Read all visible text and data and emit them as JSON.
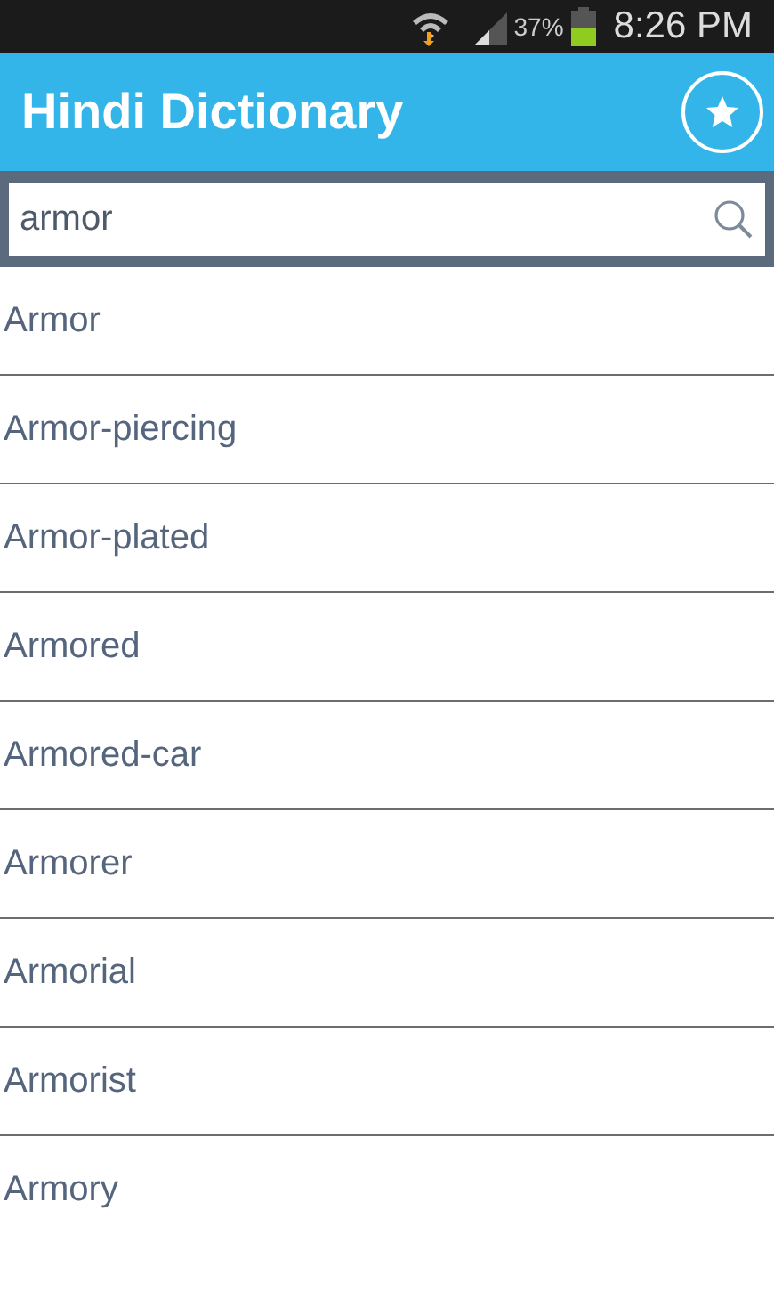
{
  "status_bar": {
    "battery": "37%",
    "time": "8:26 PM"
  },
  "app_bar": {
    "title": "Hindi Dictionary"
  },
  "search": {
    "value": "armor"
  },
  "results": [
    {
      "word": "Armor"
    },
    {
      "word": "Armor-piercing"
    },
    {
      "word": "Armor-plated"
    },
    {
      "word": "Armored"
    },
    {
      "word": "Armored-car"
    },
    {
      "word": "Armorer"
    },
    {
      "word": "Armorial"
    },
    {
      "word": "Armorist"
    },
    {
      "word": "Armory"
    }
  ]
}
